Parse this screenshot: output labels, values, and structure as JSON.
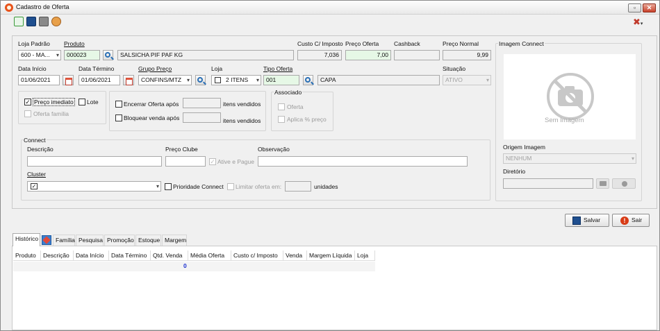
{
  "window": {
    "title": "Cadastro de Oferta",
    "restore_label": "▫",
    "close_label": "✕"
  },
  "fields": {
    "loja_padrao": {
      "label": "Loja Padrão",
      "value": "600 - MA..."
    },
    "produto": {
      "label": "Produto",
      "code": "000023",
      "description": "SALSICHA PIF PAF KG"
    },
    "custo_imposto": {
      "label": "Custo C/ Imposto",
      "value": "7,036"
    },
    "preco_oferta": {
      "label": "Preço Oferta",
      "value": "7,00"
    },
    "cashback": {
      "label": "Cashback",
      "value": ""
    },
    "preco_normal": {
      "label": "Preço Normal",
      "value": "9,99"
    },
    "data_inicio": {
      "label": "Data Início",
      "value": "01/06/2021"
    },
    "data_termino": {
      "label": "Data Término",
      "value": "01/06/2021"
    },
    "grupo_preco": {
      "label": "Grupo Preço",
      "value": "CONFINS/MTZ"
    },
    "loja": {
      "label": "Loja",
      "value": "2 ITENS"
    },
    "tipo_oferta": {
      "label": "Tipo Oferta",
      "code": "001",
      "description": "CAPA"
    },
    "situacao": {
      "label": "Situação",
      "value": "ATIVO"
    }
  },
  "options": {
    "preco_imediato": {
      "label": "Preço imediato",
      "checked": true
    },
    "lote": {
      "label": "Lote",
      "checked": false
    },
    "oferta_familia": {
      "label": "Oferta família",
      "checked": false
    },
    "encerrar_oferta": {
      "label": "Encerrar Oferta após",
      "suffix": "itens vendidos"
    },
    "bloquear_venda": {
      "label": "Bloquear venda após",
      "suffix": "itens vendidos"
    }
  },
  "associado": {
    "title": "Associado",
    "oferta_label": "Oferta",
    "aplica_label": "Aplica % preço"
  },
  "connect": {
    "title": "Connect",
    "descricao_label": "Descrição",
    "preco_clube_label": "Preço Clube",
    "ative_pague_label": "Ative e Pague",
    "observacao_label": "Observação",
    "cluster_label": "Cluster",
    "prioridade_label": "Prioridade Connect",
    "limitar_label": "Limitar oferta em:",
    "unidades_label": "unidades"
  },
  "imagem": {
    "title": "Imagem Connect",
    "placeholder": "Sem Imagem",
    "origem_label": "Origem Imagem",
    "origem_value": "NENHUM",
    "diretorio_label": "Diretório"
  },
  "actions": {
    "salvar": "Salvar",
    "sair": "Sair"
  },
  "tabs": [
    "Histórico",
    "Família",
    "Pesquisa",
    "Promoção",
    "Estoque",
    "Margem"
  ],
  "table": {
    "columns": [
      "Produto",
      "Descrição",
      "Data Início",
      "Data Término",
      "Qtd. Venda",
      "Média Oferta",
      "Custo c/ Imposto",
      "Venda",
      "Margem Líquida",
      "Loja"
    ],
    "total_qtd": "0"
  },
  "colors": {
    "accent_blue": "#2a6fb5",
    "close_red": "#c9412a",
    "sair_red": "#d83b16",
    "green_field": "#e6f8e6"
  }
}
